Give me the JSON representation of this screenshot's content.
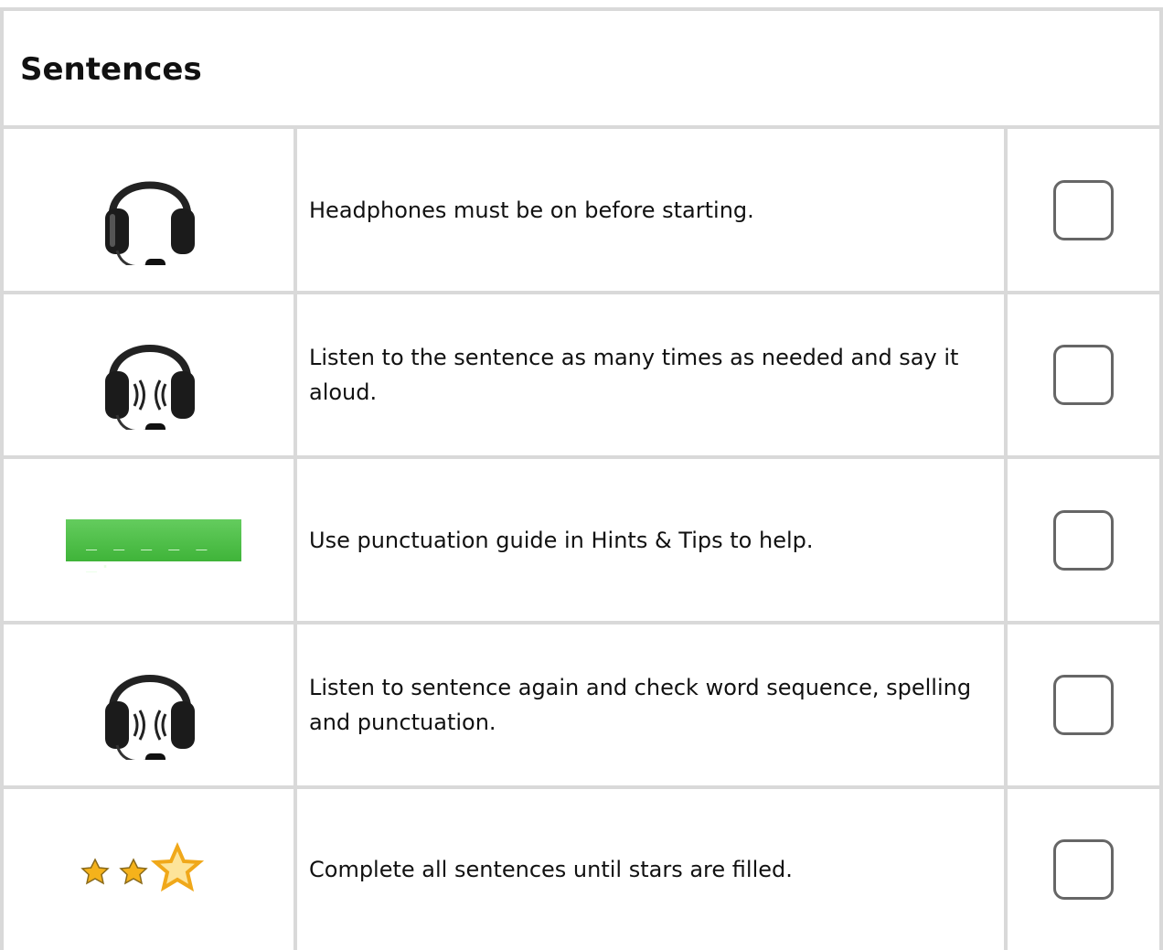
{
  "title": "Sentences",
  "rows": [
    {
      "icon": "headset-icon",
      "text": "Headphones must be on before starting."
    },
    {
      "icon": "headset-audio-icon",
      "text": "Listen to the sentence as many times as needed and say it aloud."
    },
    {
      "icon": "punctuation-guide-icon",
      "text": "Use punctuation guide in Hints & Tips to help.",
      "guide": "_ _ _ _ _ _."
    },
    {
      "icon": "headset-audio-icon",
      "text": "Listen to sentence again and check word sequence, spelling and punctuation."
    },
    {
      "icon": "stars-icon",
      "text": "Complete all sentences until stars are filled."
    }
  ],
  "colors": {
    "border": "#d9d9d9",
    "guide_bar": "#4cbf45",
    "star": "#f5b21b"
  }
}
